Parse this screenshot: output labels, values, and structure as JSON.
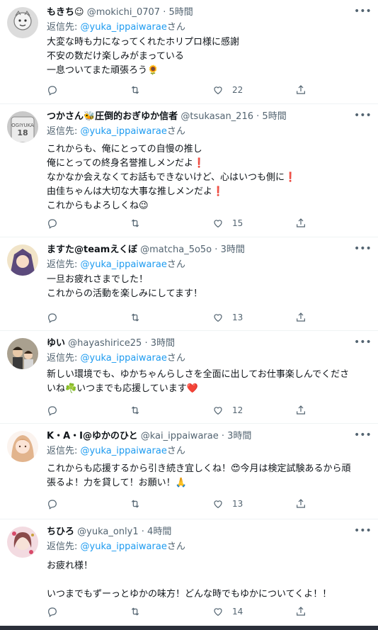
{
  "reply_prefix": "返信先:",
  "reply_suffix": "さん",
  "replies": [
    {
      "name": "もきち☺",
      "handle": "@mokichi_0707",
      "time": "5時間",
      "mention": "@yuka_ippaiwarae",
      "lines": [
        "大変な時も力になってくれたホリプロ様に感謝",
        "不安の数だけ楽しみがまっている",
        "一息ついてまた頑張ろう🌻"
      ],
      "likes": "22",
      "avatar_color": "#d9d9d9"
    },
    {
      "name": "つかさん🐝圧倒的おぎゆか信者",
      "handle": "@tsukasan_216",
      "time": "5時間",
      "mention": "@yuka_ippaiwarae",
      "lines": [
        "これからも、俺にとっての自慢の推し",
        "俺にとっての終身名誉推しメンだよ❗",
        "なかなか会えなくてお話もできないけど、心はいつも側に❗",
        "由佳ちゃんは大切な大事な推しメンだよ❗",
        "これからもよろしくね😉"
      ],
      "likes": "15",
      "avatar_color": "#b8b8b8"
    },
    {
      "name": "ますた@teamえくぼ",
      "handle": "@matcha_5o5o",
      "time": "3時間",
      "mention": "@yuka_ippaiwarae",
      "lines": [
        "一旦お疲れさまでした！",
        "これからの活動を楽しみにしてます！"
      ],
      "likes": "13",
      "avatar_color": "#6b5a8e"
    },
    {
      "name": "ゆい",
      "handle": "@hayashirice25",
      "time": "3時間",
      "mention": "@yuka_ippaiwarae",
      "lines": [
        "新しい環境でも、ゆかちゃんらしさを全面に出してお仕事楽しんでくださ",
        "いね☘️いつまでも応援しています❤️"
      ],
      "likes": "12",
      "avatar_color": "#8a7f6e"
    },
    {
      "name": "K・A・I@ゆかのひと",
      "handle": "@kai_ippaiwarae",
      "time": "3時間",
      "mention": "@yuka_ippaiwarae",
      "lines": [
        "これからも応援するから引き続き宜しくね！😍今月は検定試験あるから頑",
        "張るよ！力を貸して！お願い！🙏"
      ],
      "likes": "13",
      "avatar_color": "#e8c9b0"
    },
    {
      "name": "ちひろ",
      "handle": "@yuka_only1",
      "time": "4時間",
      "mention": "@yuka_ippaiwarae",
      "lines": [
        "お疲れ様！",
        "",
        "いつまでもずーっとゆかの味方！どんな時でもゆかについてくよ！！"
      ],
      "likes": "14",
      "avatar_color": "#e6b8c2"
    }
  ]
}
